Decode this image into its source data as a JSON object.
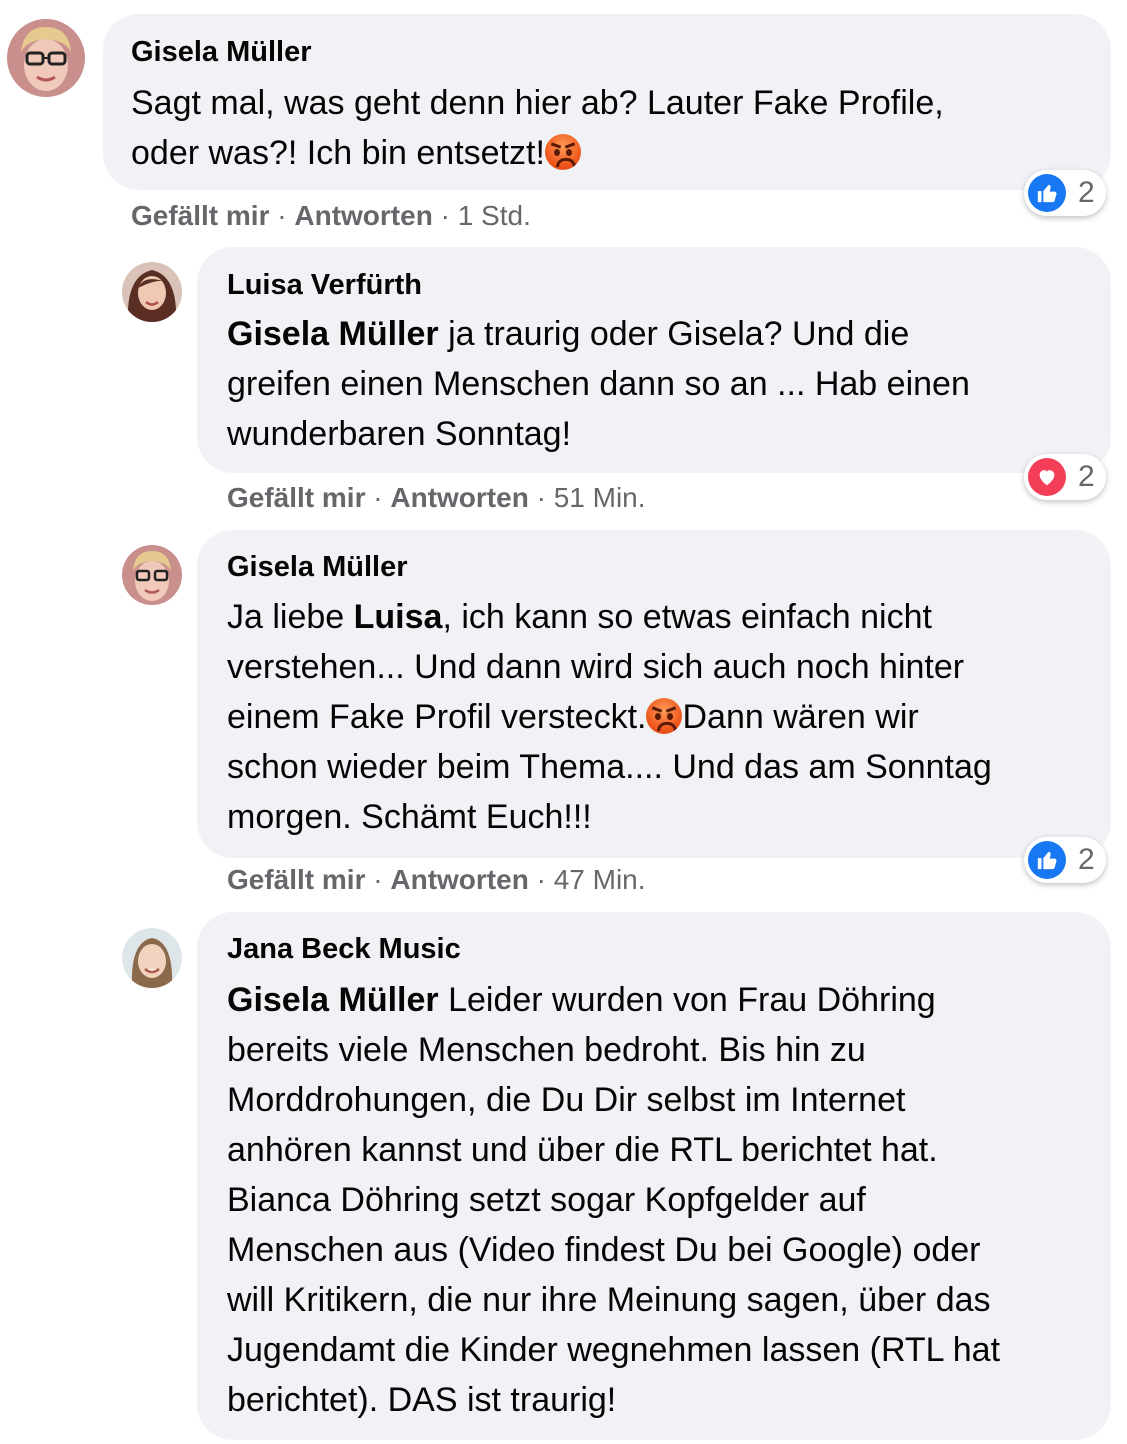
{
  "comments": [
    {
      "author": "Gisela Müller",
      "lines": [
        [
          "Sagt mal, was geht denn hier ab? Lauter Fake Profile,"
        ],
        [
          "oder was?! Ich bin entsetzt!",
          "emoji:angry-face"
        ]
      ],
      "actions": {
        "like": "Gefällt mir",
        "reply": "Antworten",
        "time": "1 Std."
      },
      "reaction": {
        "icon": "like-icon",
        "color": "#1877f2",
        "count": "2"
      }
    },
    {
      "author": "Luisa Verfürth",
      "mention": "Gisela Müller",
      "lines": [
        [
          "@mention",
          " ja traurig oder Gisela? Und die"
        ],
        [
          "greifen einen Menschen dann so an ... Hab einen"
        ],
        [
          "wunderbaren Sonntag!"
        ]
      ],
      "actions": {
        "like": "Gefällt mir",
        "reply": "Antworten",
        "time": "51 Min."
      },
      "reaction": {
        "icon": "love-icon",
        "color": "#f33e58",
        "count": "2"
      }
    },
    {
      "author": "Gisela Müller",
      "mention": "Luisa",
      "lines": [
        [
          "Ja liebe ",
          "@mention",
          ", ich kann so etwas einfach nicht"
        ],
        [
          "verstehen... Und dann wird sich auch noch hinter"
        ],
        [
          "einem Fake Profil versteckt.",
          "emoji:angry-face",
          "Dann wären wir"
        ],
        [
          "schon wieder beim Thema.... Und das am Sonntag"
        ],
        [
          "morgen. Schämt Euch!!!"
        ]
      ],
      "actions": {
        "like": "Gefällt mir",
        "reply": "Antworten",
        "time": "47 Min."
      },
      "reaction": {
        "icon": "like-icon",
        "color": "#1877f2",
        "count": "2"
      }
    },
    {
      "author": "Jana Beck Music",
      "mention": "Gisela Müller",
      "lines": [
        [
          "@mention",
          " Leider wurden von Frau Döhring"
        ],
        [
          "bereits viele Menschen bedroht. Bis hin zu"
        ],
        [
          "Morddrohungen, die Du Dir selbst im Internet"
        ],
        [
          "anhören kannst und über die RTL berichtet hat."
        ],
        [
          "Bianca Döhring setzt sogar Kopfgelder auf"
        ],
        [
          "Menschen aus (Video findest Du bei Google) oder"
        ],
        [
          "will Kritikern, die nur ihre Meinung sagen, über das"
        ],
        [
          "Jugendamt die Kinder wegnehmen lassen (RTL hat"
        ],
        [
          "berichtet). DAS ist traurig!"
        ]
      ]
    }
  ]
}
